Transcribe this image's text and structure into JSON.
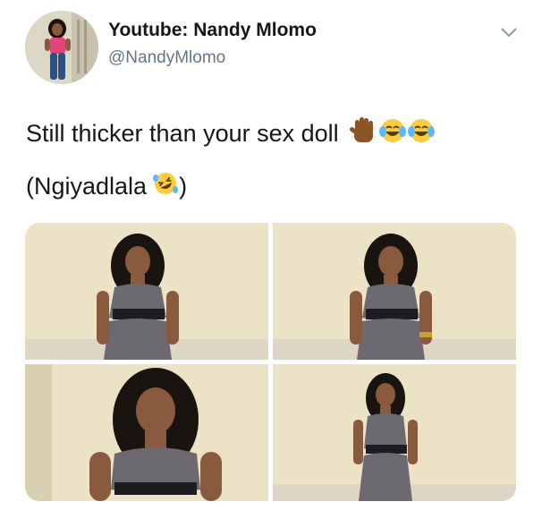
{
  "header": {
    "display_name": "Youtube: Nandy Mlomo",
    "handle": "@NandyMlomo",
    "avatar_icon": "user-avatar-photo",
    "menu_icon": "chevron-down-icon"
  },
  "tweet": {
    "line1": "Still thicker than your sex doll",
    "line1_emojis": [
      "raised-hand-emoji",
      "tears-of-joy-emoji",
      "tears-of-joy-emoji"
    ],
    "line2_prefix": "(Ngiyadlala",
    "line2_emoji": "rolling-on-floor-laughing-emoji",
    "line2_suffix": ")"
  },
  "media": {
    "count": 4,
    "photos": [
      "photo-woman-full-body",
      "photo-woman-full-body-2",
      "photo-woman-closeup",
      "photo-woman-walking"
    ]
  },
  "colors": {
    "text": "#14171a",
    "secondary": "#657786",
    "wall": "#ece3c6",
    "outfit": "#6c6a70",
    "skin": "#8a5a3e",
    "hair": "#1a1410",
    "avatar_top": "#e0457b"
  }
}
